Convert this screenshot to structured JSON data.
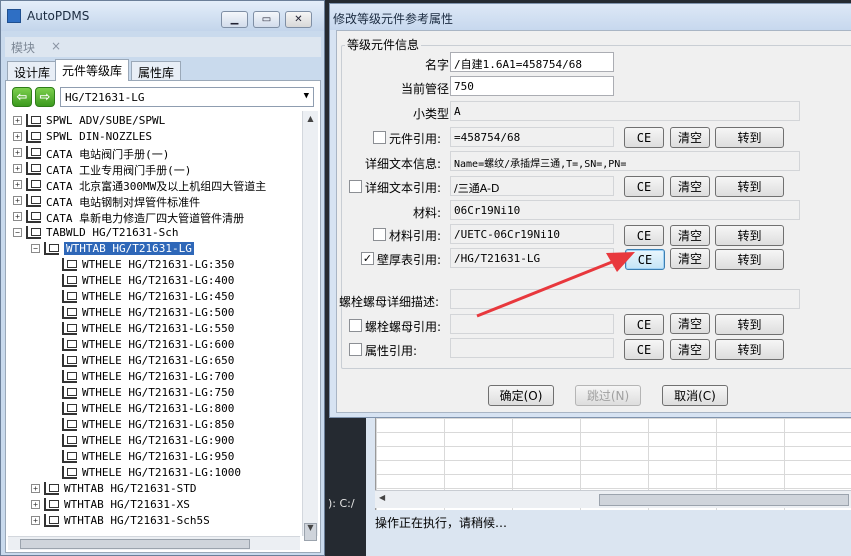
{
  "app": {
    "title": "AutoPDMS",
    "module_label": "模块",
    "module_close": "×"
  },
  "left_tabs": [
    "设计库",
    "元件等级库",
    "属性库"
  ],
  "library_select": {
    "value": "HG/T21631-LG"
  },
  "tree": [
    {
      "label": "SPWL ADV/SUBE/SPWL",
      "exp": "+"
    },
    {
      "label": "SPWL DIN-NOZZLES",
      "exp": "+"
    },
    {
      "label": "CATA 电站阀门手册(一)",
      "exp": "+"
    },
    {
      "label": "CATA 工业专用阀门手册(一)",
      "exp": "+"
    },
    {
      "label": "CATA 北京富通300MW及以上机组四大管道主",
      "exp": "+"
    },
    {
      "label": "CATA 电站钢制对焊管件标准件",
      "exp": "+"
    },
    {
      "label": "CATA 阜新电力修造厂四大管道管件清册",
      "exp": "+"
    },
    {
      "label": "TABWLD HG/T21631-Sch",
      "exp": "−"
    },
    {
      "label": "WTHTAB HG/T21631-LG",
      "exp": "−",
      "selected": true
    },
    {
      "label": "WTHELE HG/T21631-LG:350"
    },
    {
      "label": "WTHELE HG/T21631-LG:400"
    },
    {
      "label": "WTHELE HG/T21631-LG:450"
    },
    {
      "label": "WTHELE HG/T21631-LG:500"
    },
    {
      "label": "WTHELE HG/T21631-LG:550"
    },
    {
      "label": "WTHELE HG/T21631-LG:600"
    },
    {
      "label": "WTHELE HG/T21631-LG:650"
    },
    {
      "label": "WTHELE HG/T21631-LG:700"
    },
    {
      "label": "WTHELE HG/T21631-LG:750"
    },
    {
      "label": "WTHELE HG/T21631-LG:800"
    },
    {
      "label": "WTHELE HG/T21631-LG:850"
    },
    {
      "label": "WTHELE HG/T21631-LG:900"
    },
    {
      "label": "WTHELE HG/T21631-LG:950"
    },
    {
      "label": "WTHELE HG/T21631-LG:1000"
    },
    {
      "label": "WTHTAB HG/T21631-STD",
      "exp": "+"
    },
    {
      "label": "WTHTAB HG/T21631-XS",
      "exp": "+"
    },
    {
      "label": "WTHTAB HG/T21631-Sch5S",
      "exp": "+"
    }
  ],
  "dialog": {
    "title": "修改等级元件参考属性",
    "group_label": "等级元件信息",
    "fields": {
      "name": {
        "label": "名字:",
        "value": "/自建1.6A1=458754/68"
      },
      "pipe": {
        "label": "当前管径:",
        "value": "750"
      },
      "subtype": {
        "label": "小类型:",
        "value": "A"
      },
      "elem_ref": {
        "label": "元件引用:",
        "value": "=458754/68",
        "checked": false
      },
      "detail_info": {
        "label": "详细文本信息:",
        "value": "Name=螺纹/承插焊三通,T=,SN=,PN="
      },
      "detail_ref": {
        "label": "详细文本引用:",
        "value": "/三通A-D",
        "checked": false
      },
      "material": {
        "label": "材料:",
        "value": "06Cr19Ni10"
      },
      "mat_ref": {
        "label": "材料引用:",
        "value": "/UETC-06Cr19Ni10",
        "checked": false
      },
      "wall_ref": {
        "label": "壁厚表引用:",
        "value": "/HG/T21631-LG",
        "checked": true
      },
      "bolt_desc": {
        "label": "螺栓螺母详细描述:",
        "value": ""
      },
      "bolt_ref": {
        "label": "螺栓螺母引用:",
        "value": "",
        "checked": false
      },
      "attr_ref": {
        "label": "属性引用:",
        "value": "",
        "checked": false
      }
    },
    "row_buttons": {
      "ce": "CE",
      "clear": "清空",
      "goto": "转到"
    },
    "ok": "确定(O)",
    "skip": "跳过(N)",
    "cancel": "取消(C)"
  },
  "background": {
    "drive_text": "): C:/",
    "status": "操作正在执行，请稍候…"
  },
  "colors": {
    "selection": "#2e67b8",
    "annotation_arrow": "#e8383d"
  }
}
